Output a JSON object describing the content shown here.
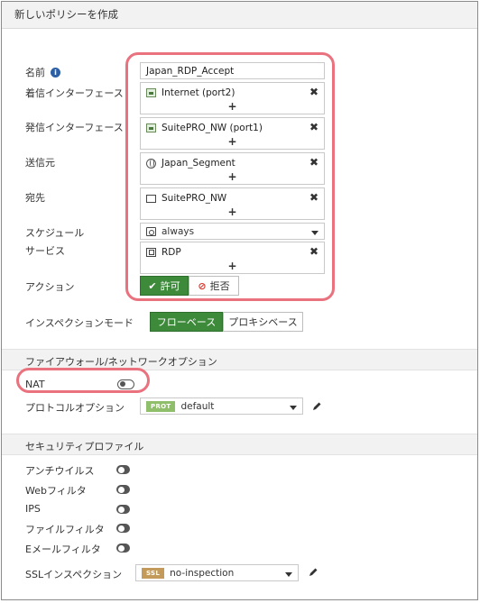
{
  "title": "新しいポリシーを作成",
  "form": {
    "name_label": "名前",
    "name_value": "Japan_RDP_Accept",
    "incoming_label": "着信インターフェース",
    "incoming_value": "Internet (port2)",
    "outgoing_label": "発信インターフェース",
    "outgoing_value": "SuitePRO_NW (port1)",
    "source_label": "送信元",
    "source_value": "Japan_Segment",
    "destination_label": "宛先",
    "destination_value": "SuitePRO_NW",
    "schedule_label": "スケジュール",
    "schedule_value": "always",
    "service_label": "サービス",
    "service_value": "RDP",
    "action_label": "アクション",
    "action_accept": "許可",
    "action_deny": "拒否",
    "inspection_label": "インスペクションモード",
    "inspection_flow": "フローベース",
    "inspection_proxy": "プロキシベース"
  },
  "firewall_section": {
    "title": "ファイアウォール/ネットワークオプション",
    "nat_label": "NAT",
    "nat_enabled": false,
    "protocol_label": "プロトコルオプション",
    "protocol_badge": "PROT",
    "protocol_value": "default"
  },
  "security_section": {
    "title": "セキュリティプロファイル",
    "items": [
      {
        "label": "アンチウイルス",
        "enabled": false
      },
      {
        "label": "Webフィルタ",
        "enabled": false
      },
      {
        "label": "IPS",
        "enabled": false
      },
      {
        "label": "ファイルフィルタ",
        "enabled": false
      },
      {
        "label": "Eメールフィルタ",
        "enabled": false
      }
    ],
    "ssl_label": "SSLインスペクション",
    "ssl_badge": "SSL",
    "ssl_value": "no-inspection"
  },
  "icons": {
    "remove": "close-icon",
    "add": "plus-icon",
    "edit": "pencil-icon",
    "info": "info-icon"
  },
  "colors": {
    "accent_green": "#3d8a3a",
    "highlight": "#e9727e",
    "prot_badge": "#8fbf6a",
    "ssl_badge": "#c49a5a"
  }
}
